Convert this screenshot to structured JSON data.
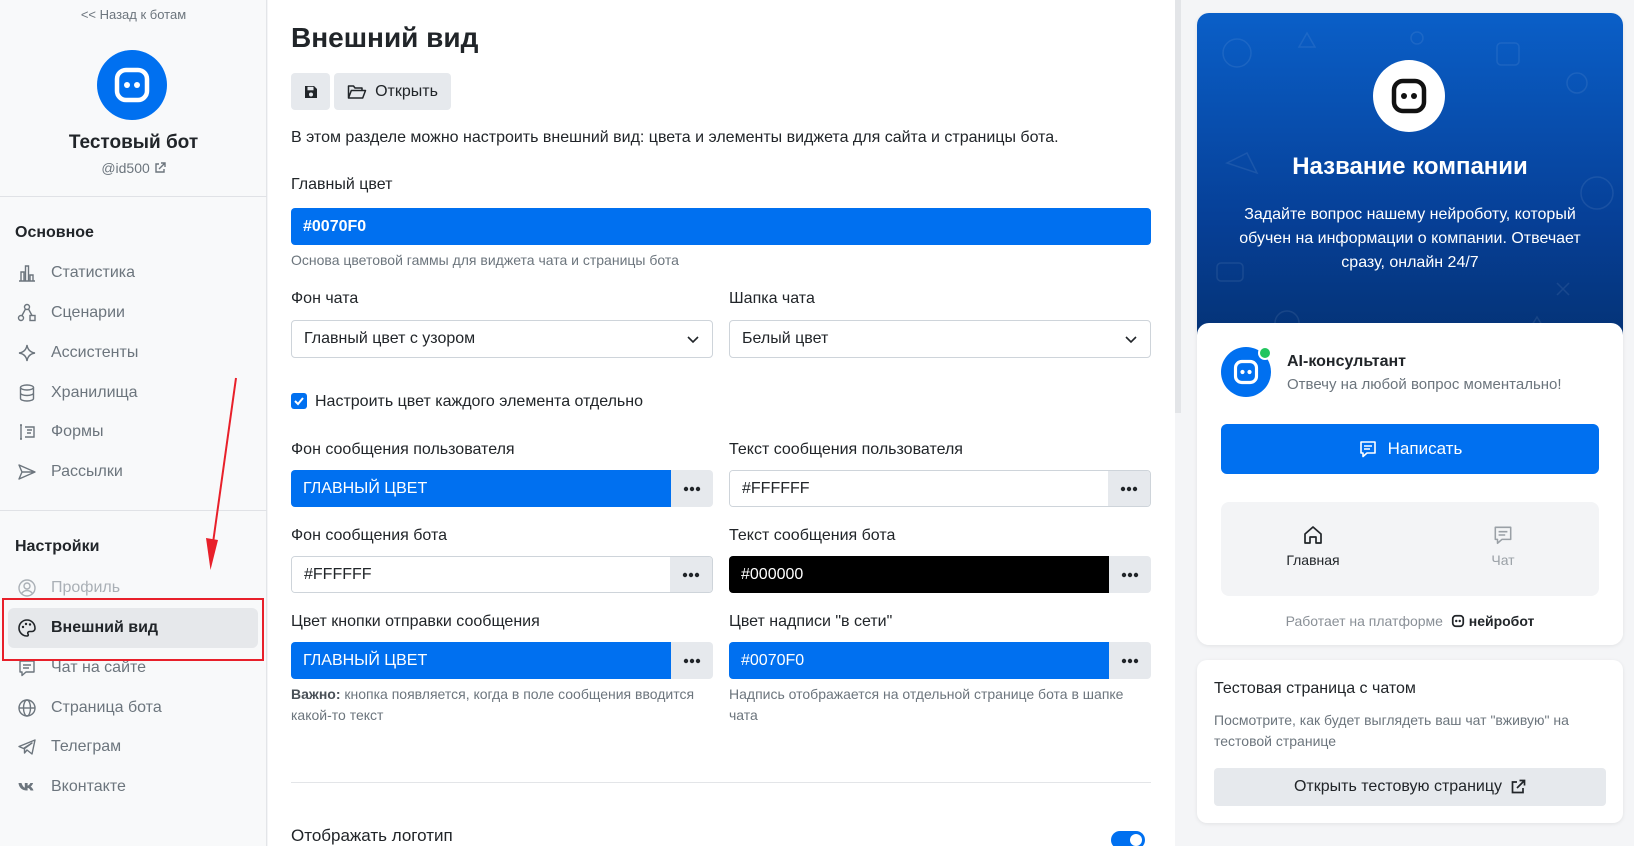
{
  "sidebar": {
    "back_link": "<< Назад к ботам",
    "bot_name": "Тестовый бот",
    "bot_handle": "@id500",
    "section_main": "Основное",
    "main_items": [
      {
        "label": "Статистика",
        "icon": "bar-chart-icon"
      },
      {
        "label": "Сценарии",
        "icon": "flow-icon"
      },
      {
        "label": "Ассистенты",
        "icon": "sparkle-icon"
      },
      {
        "label": "Хранилища",
        "icon": "database-icon"
      },
      {
        "label": "Формы",
        "icon": "form-icon"
      },
      {
        "label": "Рассылки",
        "icon": "send-icon"
      }
    ],
    "section_settings": "Настройки",
    "settings_items": [
      {
        "label": "Профиль",
        "icon": "user-circle-icon"
      },
      {
        "label": "Внешний вид",
        "icon": "palette-icon",
        "active": true
      },
      {
        "label": "Чат на сайте",
        "icon": "chat-icon"
      },
      {
        "label": "Страница бота",
        "icon": "globe-icon"
      },
      {
        "label": "Телеграм",
        "icon": "telegram-icon"
      },
      {
        "label": "Вконтакте",
        "icon": "vk-icon"
      }
    ]
  },
  "main": {
    "title": "Внешний вид",
    "open_label": "Открыть",
    "intro": "В этом разделе можно настроить внешний вид: цвета и элементы виджета для сайта и страницы бота.",
    "primary_color_label": "Главный цвет",
    "primary_color_value": "#0070F0",
    "primary_color_hint": "Основа цветовой гаммы для виджета чата и страницы бота",
    "chat_bg_label": "Фон чата",
    "chat_bg_value": "Главный цвет с узором",
    "chat_header_label": "Шапка чата",
    "chat_header_value": "Белый цвет",
    "per_element_label": "Настроить цвет каждого элемента отдельно",
    "user_msg_bg_label": "Фон сообщения пользователя",
    "user_msg_bg_value": "ГЛАВНЫЙ ЦВЕТ",
    "user_msg_text_label": "Текст сообщения пользователя",
    "user_msg_text_value": "#FFFFFF",
    "bot_msg_bg_label": "Фон сообщения бота",
    "bot_msg_bg_value": "#FFFFFF",
    "bot_msg_text_label": "Текст сообщения бота",
    "bot_msg_text_value": "#000000",
    "send_btn_label": "Цвет кнопки отправки сообщения",
    "send_btn_value": "ГЛАВНЫЙ ЦВЕТ",
    "send_btn_hint_bold": "Важно:",
    "send_btn_hint": " кнопка появляется, когда в поле сообщения вводится какой-то текст",
    "online_label": "Цвет надписи \"в сети\"",
    "online_value": "#0070F0",
    "online_hint": "Надпись отображается на отдельной странице бота в шапке чата",
    "show_logo_label": "Отображать логотип"
  },
  "preview": {
    "company": "Название компании",
    "description": "Задайте вопрос нашему нейроботу, который обучен на информации о компании. Отвечает сразу, онлайн 24/7",
    "ai_name": "AI-консультант",
    "ai_sub": "Отвечу на любой вопрос моментально!",
    "write_label": "Написать",
    "tab_home": "Главная",
    "tab_chat": "Чат",
    "powered_prefix": "Работает на платформе",
    "powered_brand": "нейробот"
  },
  "test_page": {
    "title": "Тестовая страница с чатом",
    "description": "Посмотрите, как будет выглядеть ваш чат \"вживую\" на тестовой странице",
    "button": "Открыть тестовую страницу"
  },
  "colors": {
    "primary": "#0070F0",
    "annotation": "#E8202A"
  }
}
